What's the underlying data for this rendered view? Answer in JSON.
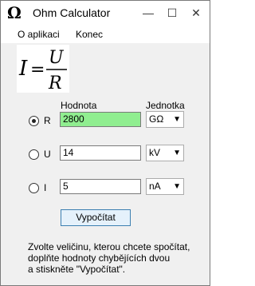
{
  "window": {
    "title": "Ohm Calculator",
    "icon_glyph": "Ω",
    "controls": {
      "minimize": "—",
      "maximize": "☐",
      "close": "✕"
    }
  },
  "menu": {
    "items": [
      "O aplikaci",
      "Konec"
    ]
  },
  "formula": {
    "lhs": "I",
    "eq": "=",
    "numerator": "U",
    "denominator": "R"
  },
  "columns": {
    "value": "Hodnota",
    "unit": "Jednotka"
  },
  "rows": [
    {
      "label": "R",
      "selected": true,
      "value": "2800",
      "unit": "GΩ",
      "highlight": "#90ee90"
    },
    {
      "label": "U",
      "selected": false,
      "value": "14",
      "unit": "kV"
    },
    {
      "label": "I",
      "selected": false,
      "value": "5",
      "unit": "nA"
    }
  ],
  "calculate_button": "Vypočítat",
  "hint": [
    "Zvolte veličinu, kterou chcete spočítat,",
    "doplňte hodnoty chybějících dvou",
    "a stiskněte \"Vypočítat\"."
  ]
}
